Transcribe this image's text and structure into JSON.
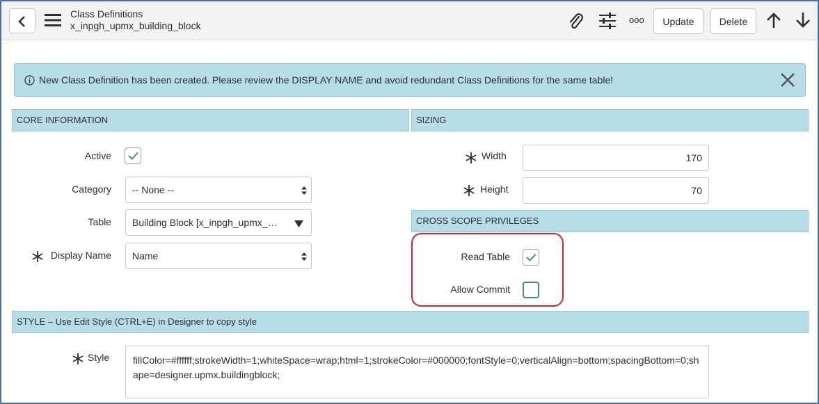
{
  "header": {
    "title": "Class Definitions",
    "subtitle": "x_inpgh_upmx_building_block",
    "update_label": "Update",
    "delete_label": "Delete",
    "more_label": "ooo"
  },
  "alert": {
    "message": "New Class Definition has been created. Please review the DISPLAY NAME and avoid redundant Class Definitions for the same table!"
  },
  "core": {
    "title": "CORE INFORMATION",
    "active_label": "Active",
    "active_checked": true,
    "category_label": "Category",
    "category_value": "-- None --",
    "table_label": "Table",
    "table_value": "Building Block [x_inpgh_upmx_…",
    "display_name_label": "Display Name",
    "display_name_value": "Name"
  },
  "sizing": {
    "title": "SIZING",
    "width_label": "Width",
    "width_value": "170",
    "height_label": "Height",
    "height_value": "70"
  },
  "cross_scope": {
    "title": "CROSS SCOPE PRIVILEGES",
    "read_table_label": "Read Table",
    "read_table_checked": true,
    "allow_commit_label": "Allow Commit",
    "allow_commit_checked": false
  },
  "style": {
    "title": "STYLE – Use Edit Style (CTRL+E) in Designer to copy style",
    "label": "Style",
    "value": "fillColor=#ffffff;strokeWidth=1;whiteSpace=wrap;html=1;strokeColor=#000000;fontStyle=0;verticalAlign=bottom;spacingBottom=0;shape=designer.upmx.buildingblock;"
  },
  "colors": {
    "section_bg": "#b7dde6",
    "check_teal": "#3d8f8c",
    "highlight_red": "#e0202a"
  }
}
